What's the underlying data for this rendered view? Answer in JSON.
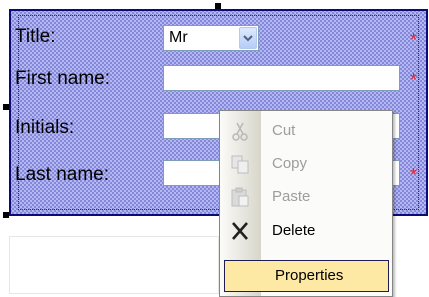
{
  "form": {
    "title_label": "Title:",
    "title_value": "Mr",
    "first_name_label": "First name:",
    "initials_label": "Initials:",
    "last_name_label": "Last name:",
    "required_marker": "*"
  },
  "context_menu": {
    "items": [
      {
        "label": "Cut",
        "enabled": false,
        "icon": "scissors-icon"
      },
      {
        "label": "Copy",
        "enabled": false,
        "icon": "copy-icon"
      },
      {
        "label": "Paste",
        "enabled": false,
        "icon": "paste-icon"
      },
      {
        "label": "Delete",
        "enabled": true,
        "icon": "delete-x-icon"
      },
      {
        "label": "Properties",
        "enabled": true,
        "highlighted": true
      }
    ]
  },
  "colors": {
    "selection_border": "#0a0a78",
    "selection_fill": "#b3b8f0",
    "required": "#e8232d",
    "menu_highlight": "#fde9a4"
  }
}
